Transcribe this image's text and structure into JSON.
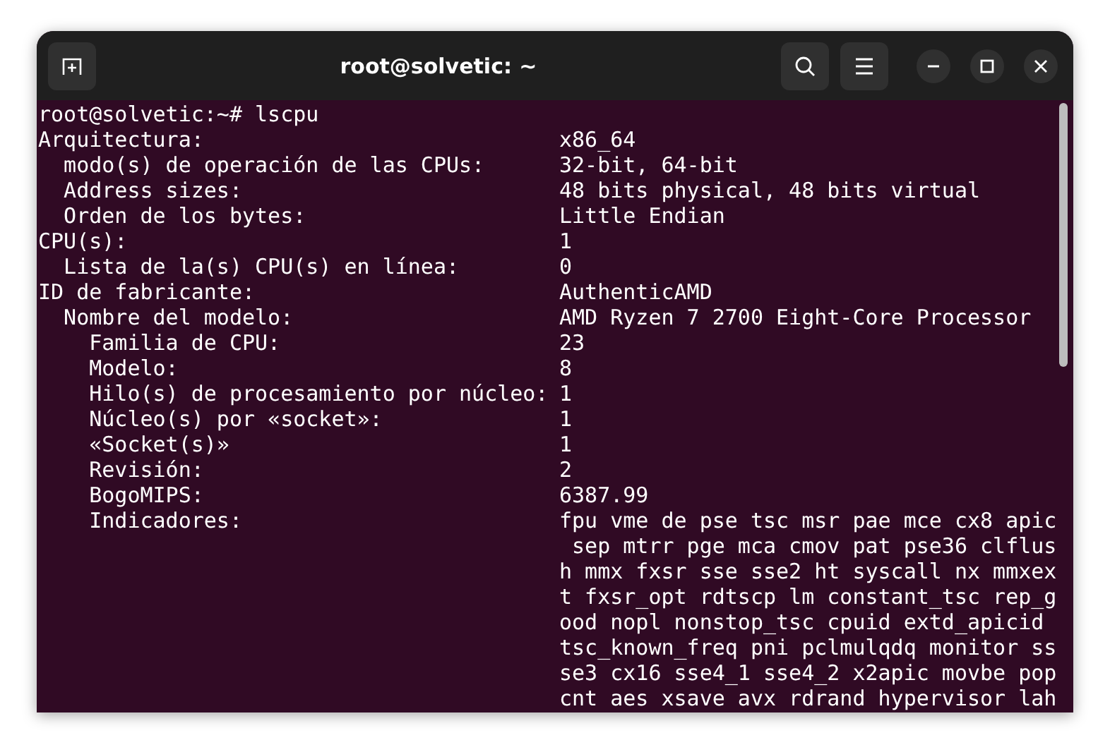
{
  "window": {
    "title": "root@solvetic: ~"
  },
  "terminal": {
    "prompt": "root@solvetic:~# lscpu",
    "lines": [
      {
        "label": "Arquitectura:",
        "value": "x86_64",
        "children": [
          {
            "label": "modo(s) de operación de las CPUs:",
            "value": "32-bit, 64-bit"
          },
          {
            "label": "Address sizes:",
            "value": "48 bits physical, 48 bits virtual"
          },
          {
            "label": "Orden de los bytes:",
            "value": "Little Endian"
          }
        ]
      },
      {
        "label": "CPU(s):",
        "value": "1",
        "children": [
          {
            "label": "Lista de la(s) CPU(s) en línea:",
            "value": "0"
          }
        ]
      },
      {
        "label": "ID de fabricante:",
        "value": "AuthenticAMD",
        "children": [
          {
            "label": "Nombre del modelo:",
            "value": "AMD Ryzen 7 2700 Eight-Core Processor",
            "children": [
              {
                "label": "Familia de CPU:",
                "value": "23"
              },
              {
                "label": "Modelo:",
                "value": "8"
              },
              {
                "label": "Hilo(s) de procesamiento por núcleo:",
                "value": "1"
              },
              {
                "label": "Núcleo(s) por «socket»:",
                "value": "1"
              },
              {
                "label": "«Socket(s)»",
                "value": "1"
              },
              {
                "label": "Revisión:",
                "value": "2"
              },
              {
                "label": "BogoMIPS:",
                "value": "6387.99"
              },
              {
                "label": "Indicadores:",
                "value_lines": [
                  "fpu vme de pse tsc msr pae mce cx8 apic",
                  " sep mtrr pge mca cmov pat pse36 clflus",
                  "h mmx fxsr sse sse2 ht syscall nx mmxex",
                  "t fxsr_opt rdtscp lm constant_tsc rep_g",
                  "ood nopl nonstop_tsc cpuid extd_apicid",
                  "tsc_known_freq pni pclmulqdq monitor ss",
                  "se3 cx16 sse4_1 sse4_2 x2apic movbe pop",
                  "cnt aes xsave avx rdrand hypervisor lah"
                ]
              }
            ]
          }
        ]
      }
    ]
  }
}
